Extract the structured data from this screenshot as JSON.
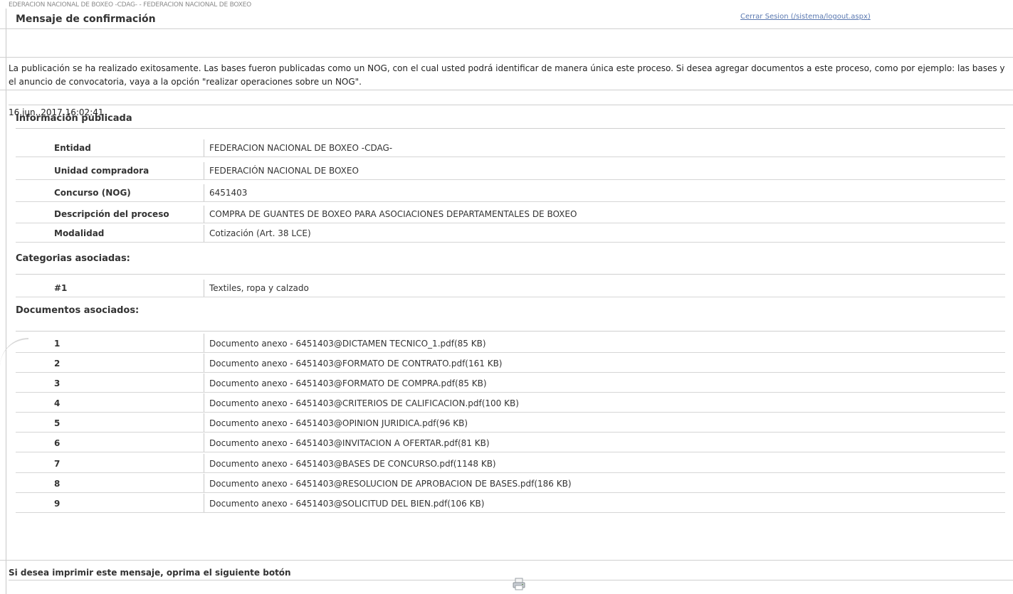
{
  "header": {
    "strip_text": "EDERACION NACIONAL DE BOXEO -CDAG- - FEDERACION NACIONAL DE BOXEO",
    "title": "Mensaje de confirmación",
    "logout_link": "Cerrar Sesion (/sistema/logout.aspx)"
  },
  "message": "La publicación se ha realizado exitosamente. Las bases fueron publicadas como un NOG, con el cual usted podrá identificar de manera única este proceso. Si desea agregar documentos a este proceso, como por ejemplo: las bases y el anuncio de convocatoria, vaya a la opción \"realizar operaciones sobre un NOG\".",
  "datetime": "16.jun..2017 16:02:41",
  "published": {
    "heading": "Información publicada",
    "rows": [
      {
        "label": "Entidad",
        "value": "FEDERACION NACIONAL DE BOXEO -CDAG-"
      },
      {
        "label": "Unidad compradora",
        "value": "FEDERACIÓN NACIONAL DE BOXEO"
      },
      {
        "label": "Concurso (NOG)",
        "value": "6451403"
      },
      {
        "label": "Descripción del proceso",
        "value": "COMPRA DE GUANTES DE BOXEO PARA ASOCIACIONES DEPARTAMENTALES DE BOXEO"
      },
      {
        "label": "Modalidad",
        "value": "Cotización (Art. 38 LCE)"
      }
    ]
  },
  "categories": {
    "heading": "Categorias asociadas:",
    "rows": [
      {
        "label": "#1",
        "value": "Textiles, ropa y calzado"
      }
    ]
  },
  "documents": {
    "heading": "Documentos asociados:",
    "rows": [
      {
        "num": "1",
        "text": "Documento anexo - 6451403@DICTAMEN TECNICO_1.pdf(85 KB)"
      },
      {
        "num": "2",
        "text": "Documento anexo - 6451403@FORMATO DE CONTRATO.pdf(161 KB)"
      },
      {
        "num": "3",
        "text": "Documento anexo - 6451403@FORMATO DE COMPRA.pdf(85 KB)"
      },
      {
        "num": "4",
        "text": "Documento anexo - 6451403@CRITERIOS DE CALIFICACION.pdf(100 KB)"
      },
      {
        "num": "5",
        "text": "Documento anexo - 6451403@OPINION JURIDICA.pdf(96 KB)"
      },
      {
        "num": "6",
        "text": "Documento anexo - 6451403@INVITACION A OFERTAR.pdf(81 KB)"
      },
      {
        "num": "7",
        "text": "Documento anexo - 6451403@BASES DE CONCURSO.pdf(1148 KB)"
      },
      {
        "num": "8",
        "text": "Documento anexo - 6451403@RESOLUCION DE APROBACION DE BASES.pdf(186 KB)"
      },
      {
        "num": "9",
        "text": "Documento anexo - 6451403@SOLICITUD DEL BIEN.pdf(106 KB)"
      }
    ]
  },
  "print": {
    "label": "Si desea imprimir este mensaje, oprima el siguiente botón",
    "icon": "printer-icon"
  }
}
